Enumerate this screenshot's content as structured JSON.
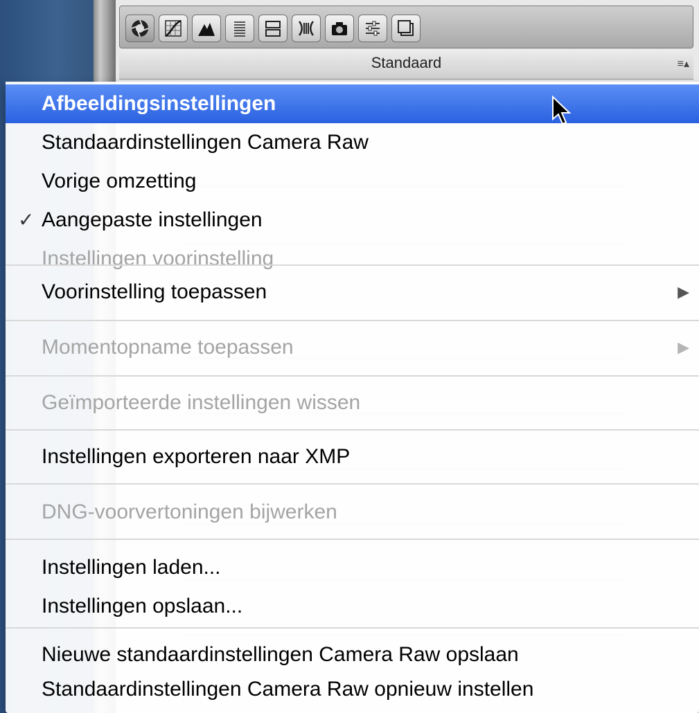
{
  "panel": {
    "title": "Standaard",
    "menu_icon": "≡▴",
    "toolbar_icons": [
      "aperture-icon",
      "tone-curve-icon",
      "mountains-icon",
      "align-lines-icon",
      "split-toning-icon",
      "lens-icon",
      "camera-icon",
      "sliders-icon",
      "layers-icon"
    ]
  },
  "menu": {
    "items": [
      {
        "label": "Afbeeldingsinstellingen",
        "state": "highlighted"
      },
      {
        "label": "Standaardinstellingen Camera Raw",
        "state": "enabled"
      },
      {
        "label": "Vorige omzetting",
        "state": "enabled"
      },
      {
        "label": "Aangepaste instellingen",
        "state": "checked",
        "check": "✓"
      },
      {
        "label": "Instellingen voorinstelling",
        "state": "disabled"
      },
      {
        "label": "Voorinstelling toepassen",
        "state": "enabled",
        "submenu": "▶"
      },
      {
        "label": "Momentopname toepassen",
        "state": "disabled",
        "submenu": "▶"
      },
      {
        "label": "Geïmporteerde instellingen wissen",
        "state": "disabled"
      },
      {
        "label": "Instellingen exporteren naar XMP",
        "state": "enabled"
      },
      {
        "label": "DNG-voorvertoningen bijwerken",
        "state": "disabled"
      },
      {
        "label": "Instellingen laden...",
        "state": "enabled"
      },
      {
        "label": "Instellingen opslaan...",
        "state": "enabled"
      },
      {
        "label": "Nieuwe standaardinstellingen Camera Raw opslaan",
        "state": "enabled"
      },
      {
        "label": "Standaardinstellingen Camera Raw opnieuw instellen",
        "state": "enabled"
      }
    ]
  },
  "colors": {
    "highlight": "#3b73ea",
    "disabled_text": "#a4a4a4",
    "left_strip": "#3d6290"
  }
}
